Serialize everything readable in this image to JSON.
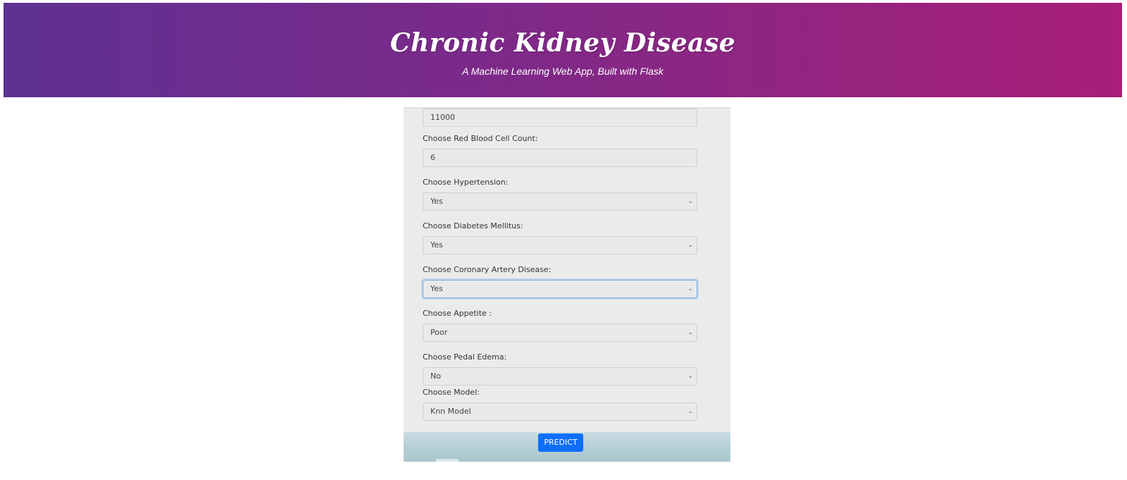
{
  "header": {
    "title": "Chronic Kidney Disease",
    "subtitle": "A Machine Learning Web App, Built with Flask"
  },
  "form": {
    "white_blood_cell_count_value": "11000",
    "red_blood_cell_count_label": "Choose Red Blood Cell Count:",
    "red_blood_cell_count_value": "6",
    "hypertension_label": "Choose Hypertension:",
    "hypertension_value": "Yes",
    "diabetes_label": "Choose Diabetes Mellitus:",
    "diabetes_value": "Yes",
    "cad_label": "Choose Coronary Artery Disease:",
    "cad_value": "Yes",
    "appetite_label": "Choose Appetite :",
    "appetite_value": "Poor",
    "pedal_edema_label": "Choose Pedal Edema:",
    "pedal_edema_value": "No",
    "model_label": "Choose Model:",
    "model_value": "Knn Model",
    "predict_label": "PREDICT"
  },
  "colors": {
    "header_gradient_start": "#5e3192",
    "header_gradient_end": "#a81e78",
    "predict_button": "#0d6efd",
    "focus_border": "#7ea8e6"
  }
}
